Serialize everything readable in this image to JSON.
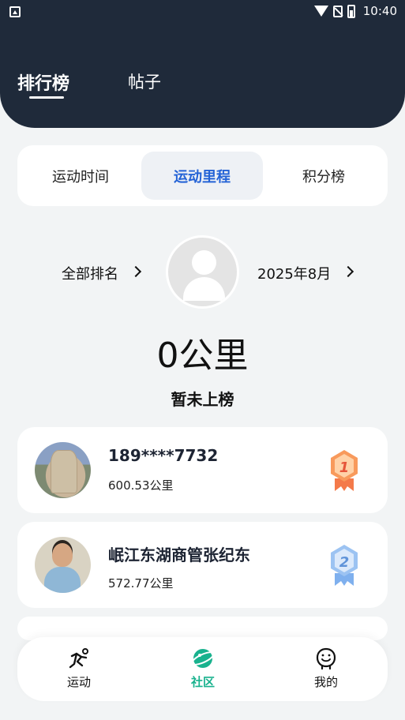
{
  "status_bar": {
    "time": "10:40"
  },
  "header": {
    "tabs": [
      {
        "label": "排行榜",
        "active": true
      },
      {
        "label": "帖子",
        "active": false
      }
    ]
  },
  "segment_tabs": [
    {
      "label": "运动时间",
      "active": false
    },
    {
      "label": "运动里程",
      "active": true
    },
    {
      "label": "积分榜",
      "active": false
    }
  ],
  "summary": {
    "rank_filter": "全部排名",
    "month": "2025年8月",
    "distance": "0公里",
    "rank_status": "暂未上榜"
  },
  "ranking": [
    {
      "name": "189****7732",
      "distance": "600.53公里",
      "rank": "1"
    },
    {
      "name": "岷江东湖商管张纪东",
      "distance": "572.77公里",
      "rank": "2"
    }
  ],
  "bottom_nav": [
    {
      "label": "运动",
      "icon": "run-icon",
      "active": false
    },
    {
      "label": "社区",
      "icon": "planet-icon",
      "active": true
    },
    {
      "label": "我的",
      "icon": "profile-face-icon",
      "active": false
    }
  ],
  "colors": {
    "header_bg": "#1f2a3a",
    "accent_blue": "#2463d6",
    "accent_green": "#19b28e",
    "gold_medal": "#f47a4a",
    "silver_medal": "#7fb0ee"
  }
}
